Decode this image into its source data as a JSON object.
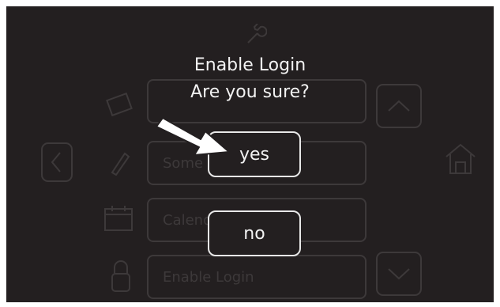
{
  "dialog": {
    "title_line1": "Enable Login",
    "title_line2": "Are you sure?",
    "yes_label": "yes",
    "no_label": "no"
  },
  "background_menu": {
    "items": [
      "",
      "Some text",
      "Calendar",
      "Enable Login"
    ]
  },
  "colors": {
    "screen_bg": "#231f20",
    "text": "#f2f2f2",
    "ghost": "#3d393a",
    "arrow": "#ffffff"
  },
  "icons": [
    "wrench-icon",
    "film-icon",
    "pencil-icon",
    "calendar-icon",
    "lock-icon",
    "home-icon",
    "chevron-left-icon",
    "chevron-up-icon",
    "chevron-down-icon",
    "pointer-arrow-icon"
  ]
}
